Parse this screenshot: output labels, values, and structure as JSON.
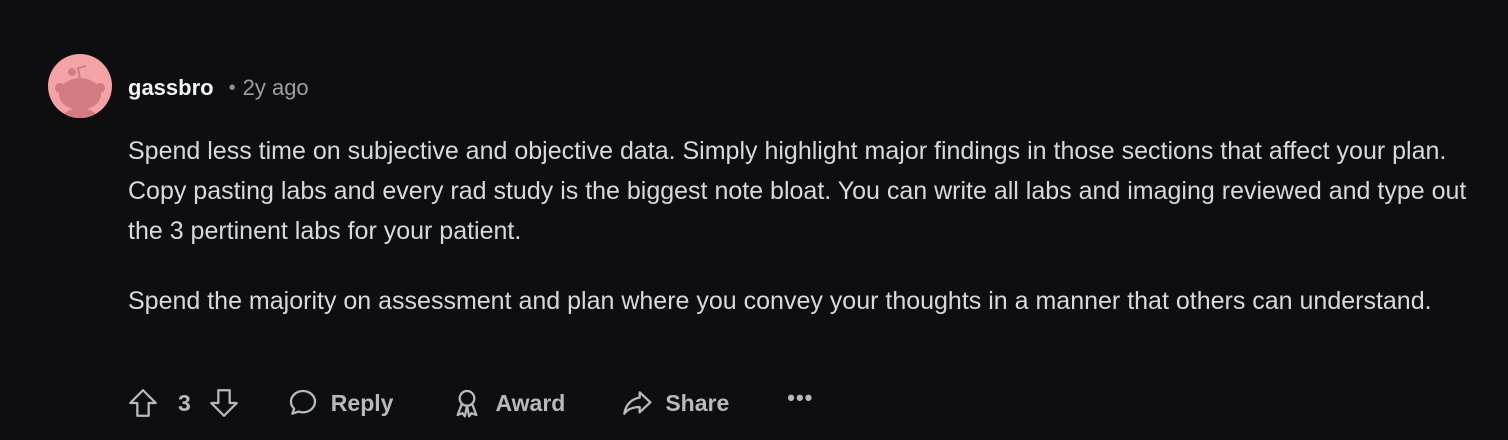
{
  "comment": {
    "author": "gassbro",
    "separator": "•",
    "age": "2y ago",
    "paragraphs": [
      "Spend less time on subjective and objective data. Simply highlight major findings in those sections that affect your plan. Copy pasting labs and every rad study is the biggest note bloat. You can write all labs and imaging reviewed and type out the 3 pertinent labs for your patient.",
      "Spend the majority on assessment and plan where you convey your thoughts in a manner that others can understand."
    ],
    "actions": {
      "vote_count": "3",
      "reply_label": "Reply",
      "award_label": "Award",
      "share_label": "Share",
      "more_label": "•••"
    }
  },
  "colors": {
    "background": "#0e0e10",
    "avatar_bg": "#f3a2a6",
    "text_primary": "#d7dadc",
    "text_muted": "#9a9fa5"
  },
  "icons": {
    "avatar": "snoo-avatar-icon",
    "upvote": "upvote-arrow-icon",
    "downvote": "downvote-arrow-icon",
    "reply": "speech-bubble-icon",
    "award": "award-ribbon-icon",
    "share": "share-arrow-icon",
    "more": "ellipsis-icon"
  }
}
